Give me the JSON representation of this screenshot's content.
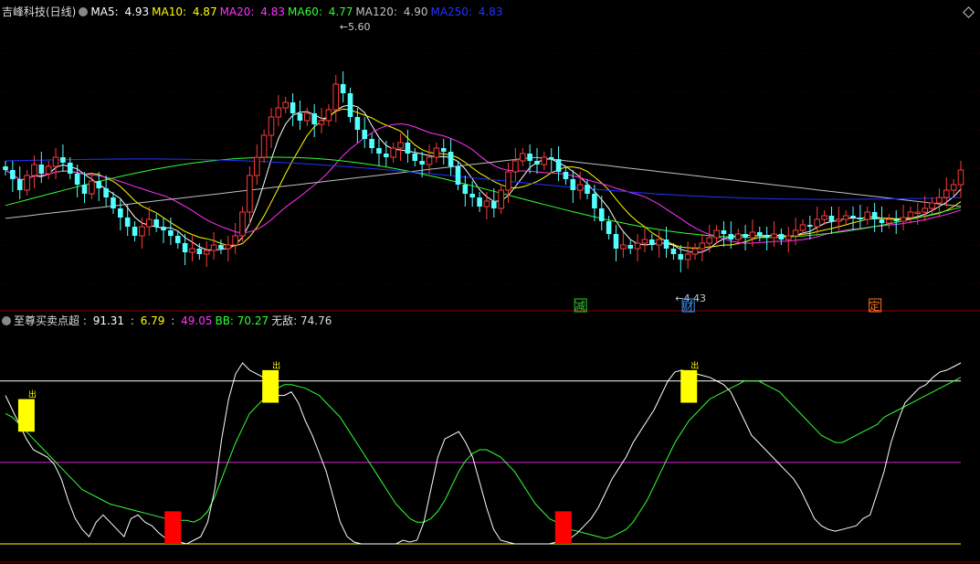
{
  "stock": {
    "title": "吉峰科技(日线)"
  },
  "ma_legend": [
    {
      "label": "MA5: ",
      "value": "4.93",
      "color": "#ffffff"
    },
    {
      "label": "MA10: ",
      "value": "4.87",
      "color": "#ffff00"
    },
    {
      "label": "MA20: ",
      "value": "4.83",
      "color": "#ff33ff"
    },
    {
      "label": "MA60: ",
      "value": "4.77",
      "color": "#33ff33"
    },
    {
      "label": "MA120: ",
      "value": "4.90",
      "color": "#c0c0c0"
    },
    {
      "label": "MA250: ",
      "value": "4.83",
      "color": "#2233ff"
    }
  ],
  "indicator": {
    "name": "至尊买卖点超 : ",
    "values": [
      {
        "text": "91.31",
        "color": "#ffffff"
      },
      {
        "text": " : ",
        "color": "#dddddd"
      },
      {
        "text": "6.79",
        "color": "#ffff00"
      },
      {
        "text": " : ",
        "color": "#dddddd"
      },
      {
        "text": "49.05",
        "color": "#ff33ff"
      },
      {
        "text": "BB: 70.27",
        "color": "#33ff33"
      },
      {
        "text": "无敌: 74.76",
        "color": "#dddddd"
      }
    ]
  },
  "chart_data": {
    "type": "candlestick",
    "price_ylim": [
      4.25,
      5.75
    ],
    "annotations": {
      "high": "5.60",
      "low": "4.43"
    },
    "event_tags": [
      {
        "label": "财",
        "color": "#3399ff"
      },
      {
        "label": "减",
        "color": "#33cc33"
      },
      {
        "label": "定",
        "color": "#ff7722"
      }
    ],
    "signal_label": "出",
    "closes": [
      4.93,
      4.88,
      4.82,
      4.9,
      4.96,
      4.91,
      4.95,
      5.0,
      4.97,
      4.91,
      4.85,
      4.8,
      4.87,
      4.83,
      4.78,
      4.72,
      4.67,
      4.62,
      4.57,
      4.62,
      4.66,
      4.62,
      4.6,
      4.57,
      4.53,
      4.48,
      4.5,
      4.47,
      4.49,
      4.52,
      4.5,
      4.52,
      4.57,
      4.7,
      4.9,
      5.0,
      5.12,
      5.22,
      5.27,
      5.3,
      5.24,
      5.2,
      5.24,
      5.18,
      5.2,
      5.26,
      5.4,
      5.35,
      5.22,
      5.15,
      5.1,
      5.05,
      5.02,
      5.0,
      5.05,
      5.08,
      5.02,
      4.98,
      4.96,
      5.0,
      5.05,
      5.03,
      4.95,
      4.85,
      4.8,
      4.78,
      4.73,
      4.76,
      4.72,
      4.82,
      4.92,
      4.98,
      5.02,
      4.98,
      4.96,
      5.0,
      4.99,
      4.92,
      4.88,
      4.82,
      4.85,
      4.8,
      4.72,
      4.65,
      4.58,
      4.5,
      4.52,
      4.5,
      4.53,
      4.55,
      4.52,
      4.55,
      4.5,
      4.47,
      4.44,
      4.47,
      4.5,
      4.53,
      4.56,
      4.6,
      4.58,
      4.55,
      4.58,
      4.56,
      4.59,
      4.57,
      4.56,
      4.58,
      4.55,
      4.57,
      4.6,
      4.63,
      4.62,
      4.66,
      4.68,
      4.65,
      4.66,
      4.68,
      4.67,
      4.66,
      4.7,
      4.66,
      4.64,
      4.66,
      4.65,
      4.67,
      4.7,
      4.7,
      4.72,
      4.75,
      4.78,
      4.82,
      4.85,
      4.93
    ],
    "lower": {
      "ylim": [
        0,
        100
      ],
      "guide_levels": [
        {
          "value": 90,
          "color": "#ffffff"
        },
        {
          "value": 45,
          "color": "#dd22dd"
        },
        {
          "value": 0,
          "color": "#ffff00"
        }
      ],
      "fast_line": [
        82,
        74,
        66,
        58,
        52,
        50,
        48,
        44,
        36,
        24,
        14,
        8,
        4,
        12,
        16,
        12,
        8,
        4,
        14,
        16,
        12,
        10,
        6,
        3,
        2,
        1,
        0,
        2,
        4,
        12,
        30,
        58,
        80,
        94,
        100,
        96,
        94,
        92,
        88,
        82,
        82,
        84,
        78,
        68,
        60,
        50,
        40,
        26,
        12,
        4,
        1,
        0,
        0,
        0,
        0,
        0,
        0,
        2,
        1,
        2,
        12,
        30,
        48,
        58,
        60,
        62,
        56,
        48,
        34,
        20,
        8,
        2,
        1,
        0,
        0,
        0,
        0,
        0,
        0,
        1,
        2,
        3,
        6,
        10,
        14,
        20,
        28,
        36,
        42,
        48,
        56,
        62,
        68,
        74,
        82,
        90,
        95,
        96,
        95,
        94,
        93,
        92,
        90,
        88,
        84,
        76,
        68,
        60,
        56,
        52,
        48,
        44,
        40,
        36,
        30,
        22,
        14,
        10,
        8,
        7,
        8,
        9,
        10,
        14,
        16,
        28,
        40,
        56,
        68,
        78,
        82,
        86,
        88,
        92,
        95,
        96,
        98,
        100
      ],
      "slow_line": [
        72,
        70,
        66,
        62,
        58,
        54,
        50,
        46,
        42,
        38,
        34,
        30,
        28,
        26,
        24,
        22,
        21,
        20,
        19,
        18,
        17,
        16,
        15,
        14,
        14,
        13,
        13,
        12,
        14,
        18,
        26,
        36,
        46,
        56,
        64,
        72,
        76,
        80,
        84,
        86,
        88,
        88,
        87,
        86,
        84,
        82,
        78,
        74,
        70,
        64,
        58,
        52,
        46,
        40,
        34,
        28,
        22,
        18,
        14,
        12,
        12,
        14,
        18,
        24,
        32,
        40,
        46,
        50,
        52,
        52,
        50,
        48,
        44,
        40,
        34,
        28,
        22,
        18,
        14,
        12,
        10,
        8,
        7,
        6,
        5,
        4,
        3,
        4,
        6,
        8,
        12,
        18,
        24,
        32,
        40,
        48,
        56,
        62,
        68,
        72,
        76,
        80,
        82,
        84,
        86,
        88,
        90,
        90,
        90,
        88,
        86,
        84,
        80,
        76,
        72,
        68,
        64,
        60,
        58,
        56,
        56,
        58,
        60,
        62,
        64,
        66,
        70,
        72,
        74,
        76,
        78,
        80,
        82,
        84,
        86,
        88,
        90,
        92
      ],
      "signal_bars": [
        {
          "index": 3,
          "from": 62,
          "to": 80,
          "color": "#ffff00"
        },
        {
          "index": 24,
          "from": 0,
          "to": 18,
          "color": "#ff0000"
        },
        {
          "index": 37,
          "from": 78,
          "to": 96,
          "color": "#ffff00"
        },
        {
          "index": 78,
          "from": 0,
          "to": 18,
          "color": "#ff0000"
        },
        {
          "index": 96,
          "from": 78,
          "to": 96,
          "color": "#ffff00"
        }
      ]
    }
  }
}
